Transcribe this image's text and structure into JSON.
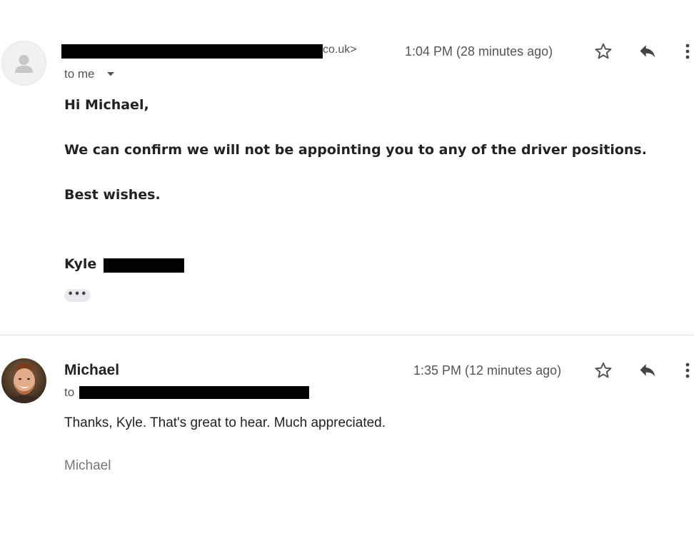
{
  "message1": {
    "sender_email_suffix": "co.uk>",
    "time": "1:04 PM (28 minutes ago)",
    "to_label": "to me",
    "greeting": "Hi Michael,",
    "body": "We can confirm we will not  be appointing you to any of the  driver positions.",
    "closing": "Best wishes.",
    "signature_first_name": "Kyle",
    "ellipsis": "•••"
  },
  "message2": {
    "sender_name": "Michael",
    "time": "1:35 PM (12 minutes ago)",
    "to_label": "to",
    "body": "Thanks, Kyle. That's great to hear. Much appreciated.",
    "signature": "Michael"
  },
  "icons": {
    "star": "star-icon",
    "reply": "reply-icon",
    "more": "more-vertical-icon",
    "dropdown": "caret-down-icon",
    "avatar_default": "person-icon"
  },
  "colors": {
    "redaction": "#000000",
    "divider": "#e3e3e3",
    "muted_text": "#555555",
    "signature_gray": "#777777"
  }
}
